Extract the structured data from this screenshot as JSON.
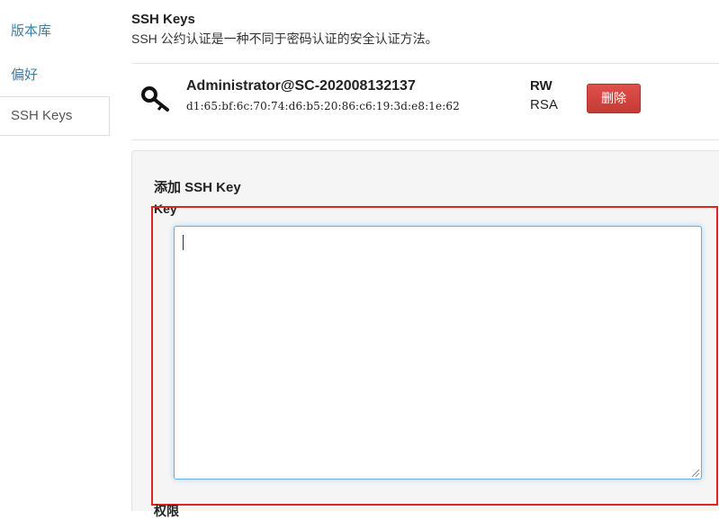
{
  "sidebar": {
    "items": [
      {
        "label": "版本库"
      },
      {
        "label": "偏好"
      },
      {
        "label": "SSH Keys"
      }
    ]
  },
  "header": {
    "title": "SSH Keys",
    "subtitle": "SSH 公约认证是一种不同于密码认证的安全认证方法。"
  },
  "key": {
    "icon": "key-icon",
    "name": "Administrator@SC-202008132137",
    "fingerprint": "d1:65:bf:6c:70:74:d6:b5:20:86:c6:19:3d:e8:1e:62",
    "permission": "RW",
    "algorithm": "RSA",
    "delete_label": "删除"
  },
  "add_form": {
    "title": "添加 SSH Key",
    "key_label": "Key",
    "key_value": "",
    "next_label": "权限"
  },
  "colors": {
    "link": "#3d7ea6",
    "danger": "#d9534f",
    "focus": "#66afe9",
    "highlight": "#e02424"
  }
}
